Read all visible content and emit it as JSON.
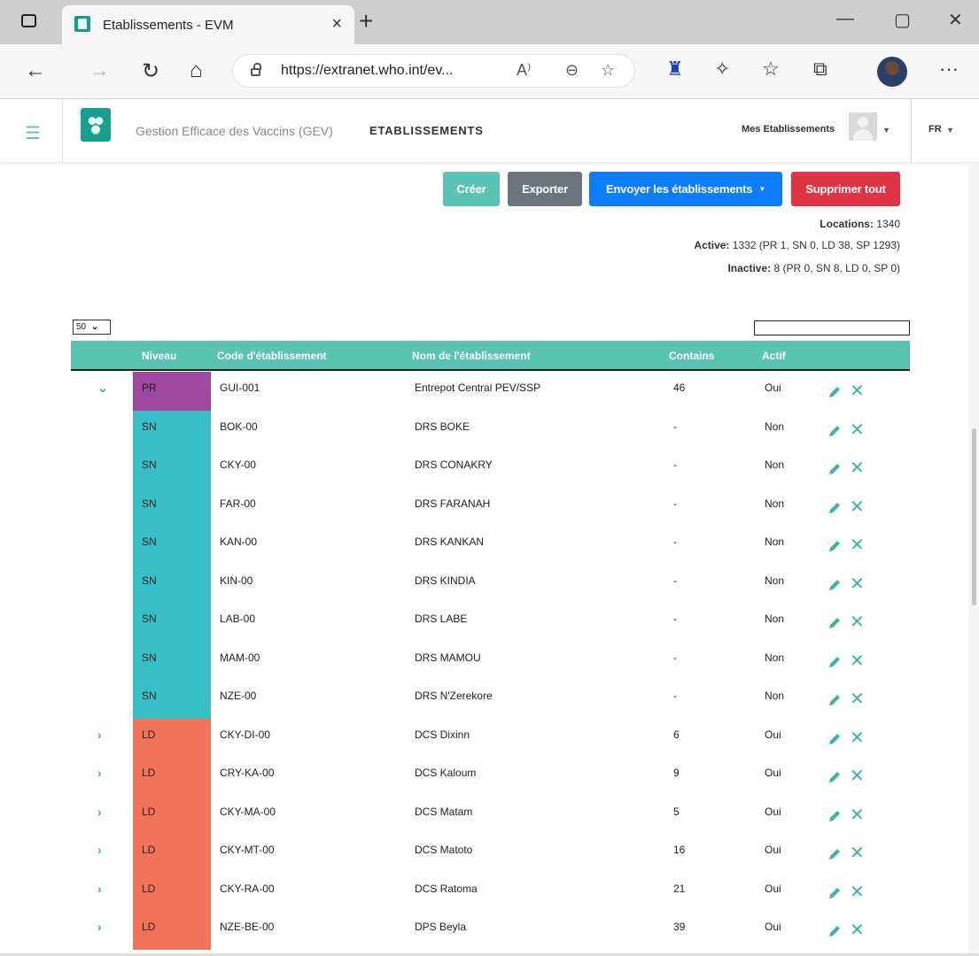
{
  "browser": {
    "tab_title": "Etablissements - EVM",
    "tab_close": "×",
    "new_tab": "+",
    "minimize": "—",
    "maximize": "▢",
    "close": "✕",
    "url": "https://extranet.who.int/ev...",
    "read_aloud": "A⁾",
    "zoom": "⊖",
    "more": "···"
  },
  "app": {
    "name": "Gestion Efficace des Vaccins (GEV)",
    "section": "ETABLISSEMENTS",
    "user_menu": "Mes Etablissements",
    "caret": "▼",
    "lang": "FR"
  },
  "actions": {
    "create": "Créer",
    "export": "Exporter",
    "send": "Envoyer les établissements",
    "send_caret": "▼",
    "delete_all": "Supprimer tout"
  },
  "stats": {
    "locations_label": "Locations:",
    "locations_value": "1340",
    "active_label": "Active:",
    "active_value": "1332 (PR 1, SN 0, LD 38, SP 1293)",
    "inactive_label": "Inactive:",
    "inactive_value": "8 (PR 0, SN 8, LD 0, SP 0)"
  },
  "table": {
    "page_size": "50",
    "page_size_caret": "⌄",
    "columns": {
      "level": "Niveau",
      "code": "Code d'établissement",
      "name": "Nom de l'établissement",
      "contains": "Contains",
      "active": "Actif"
    },
    "rows": [
      {
        "expand": "⌄",
        "level": "PR",
        "code": "GUI-001",
        "name": "Entrepot Central PEV/SSP",
        "contains": "46",
        "active": "Oui"
      },
      {
        "expand": "",
        "level": "SN",
        "code": "BOK-00",
        "name": "DRS BOKE",
        "contains": "-",
        "active": "Non"
      },
      {
        "expand": "",
        "level": "SN",
        "code": "CKY-00",
        "name": "DRS CONAKRY",
        "contains": "-",
        "active": "Non"
      },
      {
        "expand": "",
        "level": "SN",
        "code": "FAR-00",
        "name": "DRS FARANAH",
        "contains": "-",
        "active": "Non"
      },
      {
        "expand": "",
        "level": "SN",
        "code": "KAN-00",
        "name": "DRS KANKAN",
        "contains": "-",
        "active": "Non"
      },
      {
        "expand": "",
        "level": "SN",
        "code": "KIN-00",
        "name": "DRS KINDIA",
        "contains": "-",
        "active": "Non"
      },
      {
        "expand": "",
        "level": "SN",
        "code": "LAB-00",
        "name": "DRS LABE",
        "contains": "-",
        "active": "Non"
      },
      {
        "expand": "",
        "level": "SN",
        "code": "MAM-00",
        "name": "DRS MAMOU",
        "contains": "-",
        "active": "Non"
      },
      {
        "expand": "",
        "level": "SN",
        "code": "NZE-00",
        "name": "DRS N'Zerekore",
        "contains": "-",
        "active": "Non"
      },
      {
        "expand": "›",
        "level": "LD",
        "code": "CKY-DI-00",
        "name": "DCS Dixinn",
        "contains": "6",
        "active": "Oui"
      },
      {
        "expand": "›",
        "level": "LD",
        "code": "CRY-KA-00",
        "name": "DCS Kaloum",
        "contains": "9",
        "active": "Oui"
      },
      {
        "expand": "›",
        "level": "LD",
        "code": "CKY-MA-00",
        "name": "DCS Matam",
        "contains": "5",
        "active": "Oui"
      },
      {
        "expand": "›",
        "level": "LD",
        "code": "CKY-MT-00",
        "name": "DCS Matoto",
        "contains": "16",
        "active": "Oui"
      },
      {
        "expand": "›",
        "level": "LD",
        "code": "CKY-RA-00",
        "name": "DCS Ratoma",
        "contains": "21",
        "active": "Oui"
      },
      {
        "expand": "›",
        "level": "LD",
        "code": "NZE-BE-00",
        "name": "DPS Beyla",
        "contains": "39",
        "active": "Oui"
      }
    ],
    "delete_glyph": "✕"
  },
  "colors": {
    "PR": "#a0489f",
    "SN": "#38bfc5",
    "LD": "#f1735a",
    "accent": "#5ac3b4"
  }
}
